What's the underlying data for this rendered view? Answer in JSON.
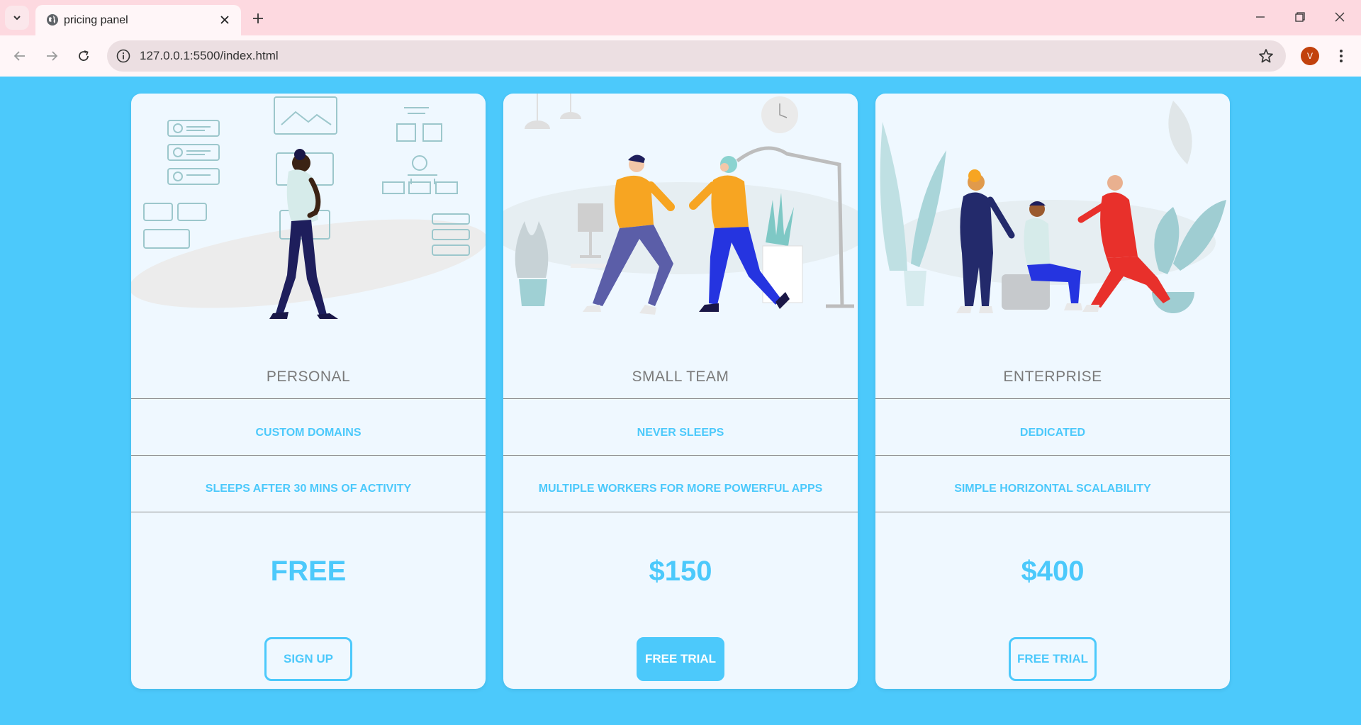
{
  "browser": {
    "tab_title": "pricing panel",
    "url": "127.0.0.1:5500/index.html",
    "profile_initial": "V"
  },
  "plans": [
    {
      "name": "PERSONAL",
      "feature_1": "CUSTOM DOMAINS",
      "feature_2": "SLEEPS AFTER 30 MINS OF ACTIVITY",
      "price": "FREE",
      "cta_label": "SIGN UP"
    },
    {
      "name": "SMALL TEAM",
      "feature_1": "NEVER SLEEPS",
      "feature_2": "MULTIPLE WORKERS FOR MORE POWERFUL APPS",
      "price": "$150",
      "cta_label": "FREE TRIAL"
    },
    {
      "name": "ENTERPRISE",
      "feature_1": "DEDICATED",
      "feature_2": "SIMPLE HORIZONTAL SCALABILITY",
      "price": "$400",
      "cta_label": "FREE TRIAL"
    }
  ],
  "colors": {
    "page_background": "#4cc9fb",
    "card_background": "#eff8ff",
    "accent": "#4cc9fb",
    "plan_name": "#7a7a7a",
    "titlebar": "#fdd9e0"
  },
  "icons": [
    "tab-search-icon",
    "globe-icon",
    "close-icon",
    "plus-icon",
    "minimize-icon",
    "restore-icon",
    "back-icon",
    "forward-icon",
    "reload-icon",
    "info-icon",
    "star-icon",
    "more-icon"
  ]
}
